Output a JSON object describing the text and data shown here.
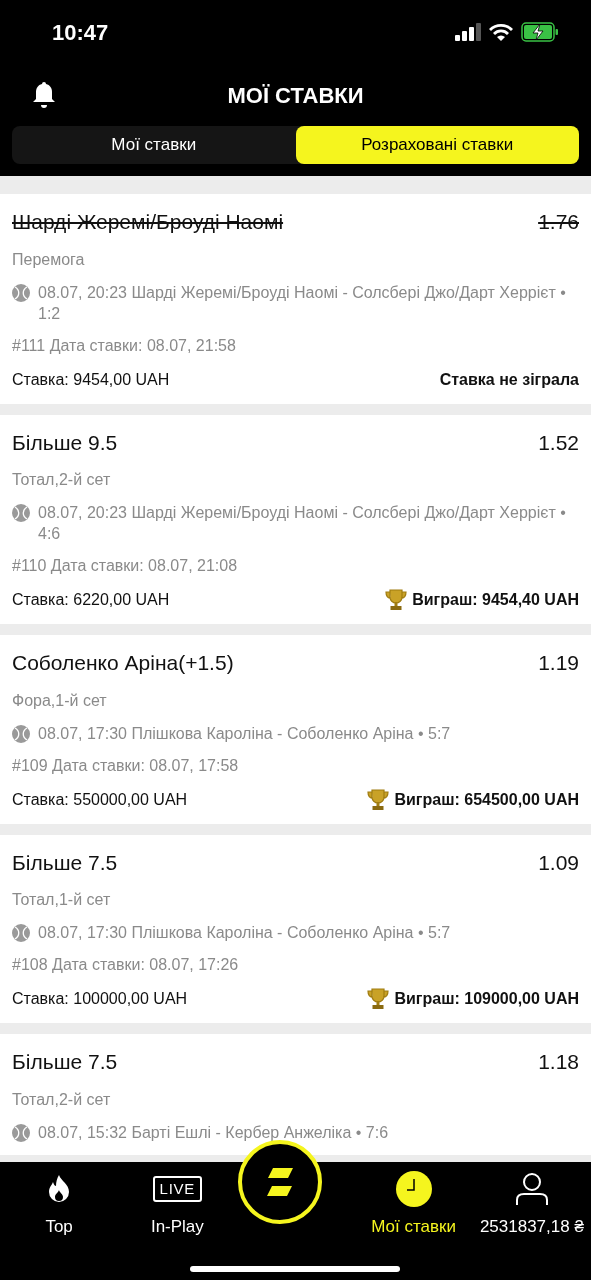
{
  "status_bar": {
    "time": "10:47"
  },
  "header": {
    "title": "МОЇ СТАВКИ"
  },
  "tabs": [
    {
      "label": "Мої ставки",
      "selected": false
    },
    {
      "label": "Розраховані ставки",
      "selected": true
    }
  ],
  "bets": [
    {
      "selection": "Шарді Жеремі/Броуді Наомі",
      "odds": "1.76",
      "market": "Перемога",
      "event": "08.07, 20:23 Шарді Жеремі/Броуді Наомі - Солсбері Джо/Дарт Херрієт • 1:2",
      "ref": "#111 Дата ставки: 08.07, 21:58",
      "stake": "Ставка: 9454,00 UAH",
      "result": "Ставка не зіграла",
      "kind": "lost"
    },
    {
      "selection": "Більше 9.5",
      "odds": "1.52",
      "market": "Тотал,2-й сет",
      "event": "08.07, 20:23 Шарді Жеремі/Броуді Наомі - Солсбері Джо/Дарт Херрієт • 4:6",
      "ref": "#110 Дата ставки: 08.07, 21:08",
      "stake": "Ставка: 6220,00 UAH",
      "result": "Виграш: 9454,40 UAH",
      "kind": "won"
    },
    {
      "selection": "Соболенко Аріна(+1.5)",
      "odds": "1.19",
      "market": "Фора,1-й сет",
      "event": "08.07, 17:30 Плішкова Кароліна - Соболенко Аріна • 5:7",
      "ref": "#109 Дата ставки: 08.07, 17:58",
      "stake": "Ставка: 550000,00 UAH",
      "result": "Виграш: 654500,00 UAH",
      "kind": "won"
    },
    {
      "selection": "Більше 7.5",
      "odds": "1.09",
      "market": "Тотал,1-й сет",
      "event": "08.07, 17:30 Плішкова Кароліна - Соболенко Аріна • 5:7",
      "ref": "#108 Дата ставки: 08.07, 17:26",
      "stake": "Ставка: 100000,00 UAH",
      "result": "Виграш: 109000,00 UAH",
      "kind": "won"
    },
    {
      "selection": "Більше 7.5",
      "odds": "1.18",
      "market": "Тотал,2-й сет",
      "event": "08.07, 15:32 Барті Ешлі - Кербер Анжеліка • 7:6",
      "kind": "partial"
    }
  ],
  "nav": [
    {
      "label": "Top",
      "kind": "flame",
      "selected": false
    },
    {
      "label": "In-Play",
      "kind": "live",
      "icon_text": "LIVE",
      "selected": false
    },
    {
      "kind": "logo"
    },
    {
      "label": "Мої ставки",
      "kind": "clock",
      "selected": true
    },
    {
      "label": "2531837,18 ₴",
      "kind": "user",
      "selected": false
    }
  ]
}
